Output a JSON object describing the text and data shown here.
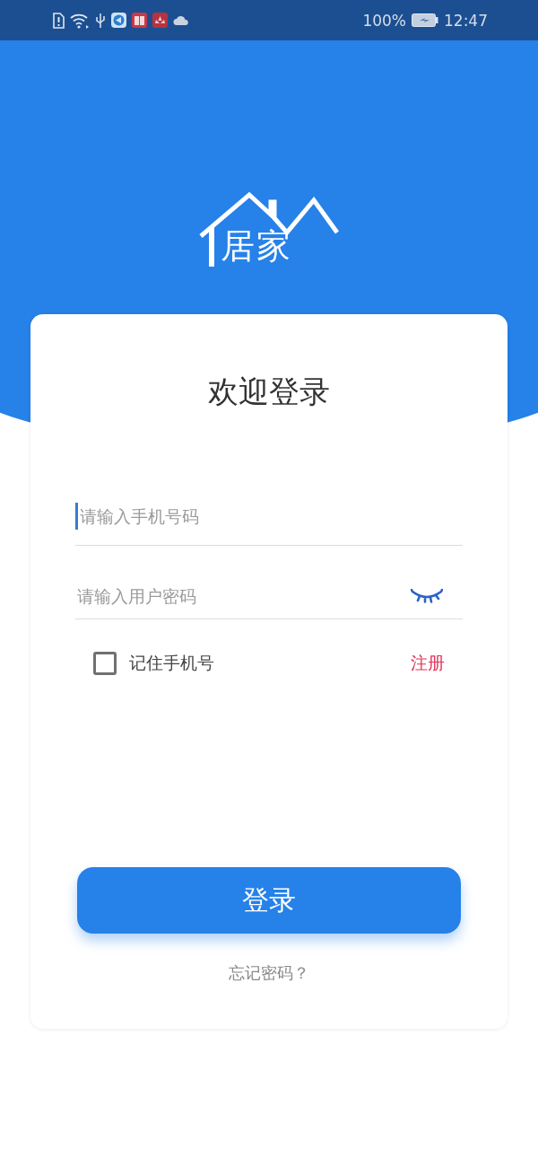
{
  "status_bar": {
    "battery": "100%",
    "time": "12:47"
  },
  "logo": {
    "text": "居家"
  },
  "login_card": {
    "title": "欢迎登录",
    "fields": [
      {
        "kind": "phone",
        "placeholder": "请输入手机号码",
        "focused": true
      },
      {
        "kind": "password",
        "placeholder": "请输入用户密码",
        "focused": false
      }
    ],
    "remember": {
      "label": "记住手机号",
      "checked": false
    },
    "register_link": "注册",
    "login_button": "登录",
    "forgot_link": "忘记密码？"
  }
}
